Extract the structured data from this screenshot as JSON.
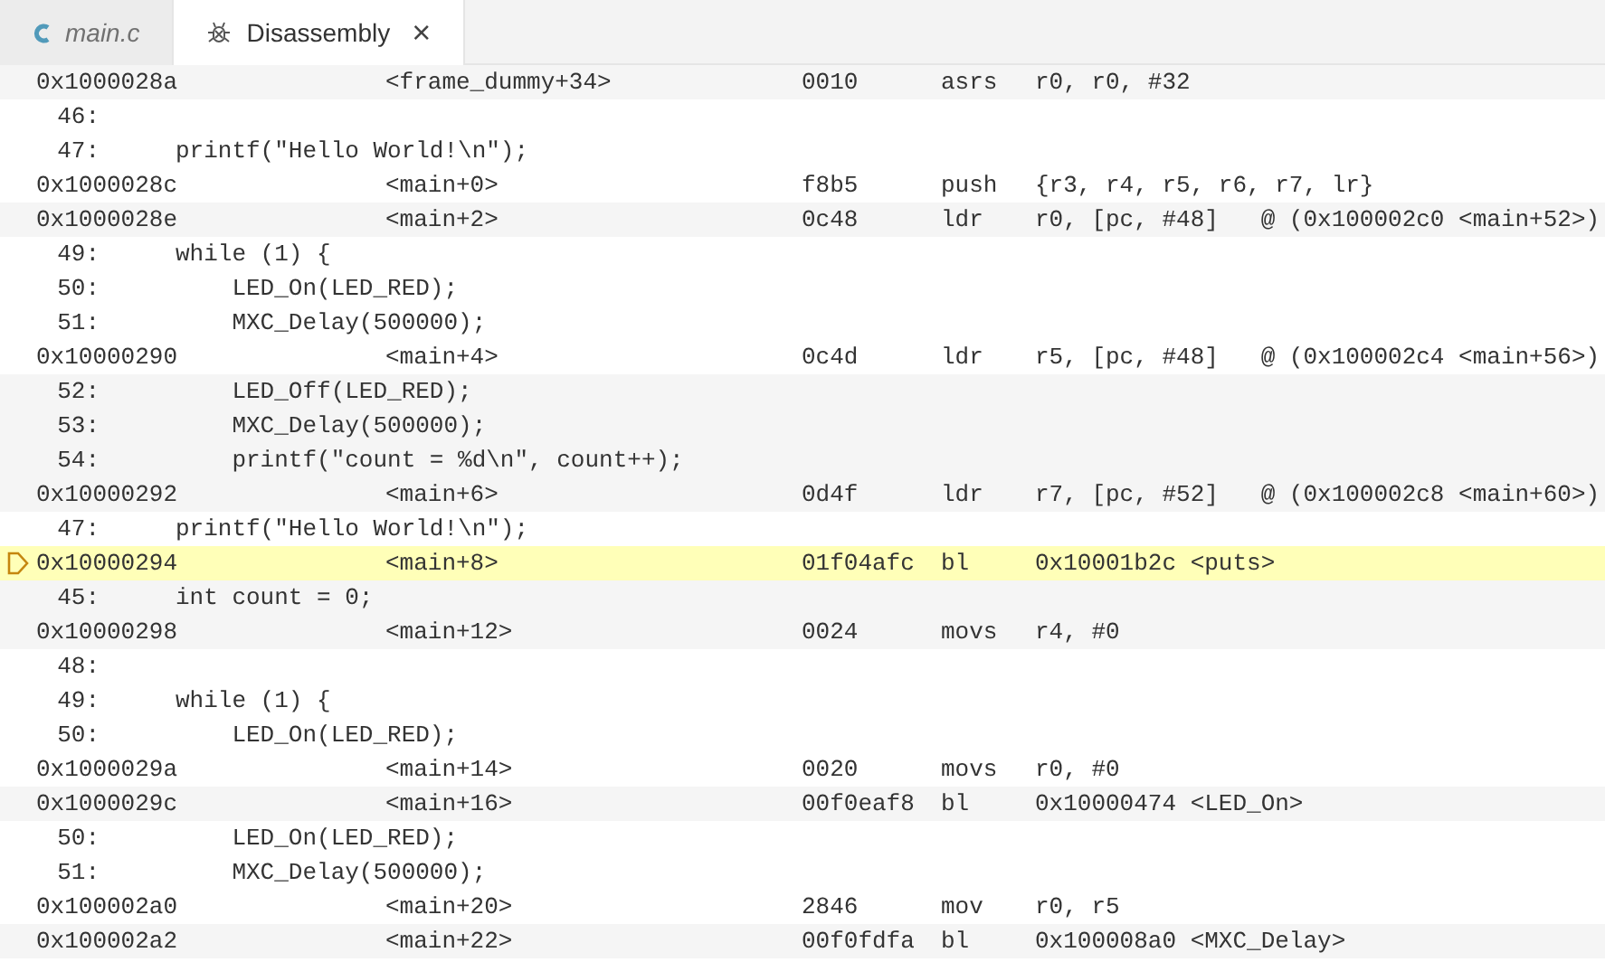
{
  "tabs": [
    {
      "label": "main.c",
      "kind": "c-file",
      "selected": false,
      "italic": true
    },
    {
      "label": "Disassembly",
      "kind": "disassembly",
      "selected": true,
      "italic": false,
      "close": "×"
    }
  ],
  "groups": [
    {
      "instruction": {
        "address": "0x1000028a",
        "symbol": "<frame_dummy+34>",
        "opcode": "0010",
        "mnemonic": "asrs",
        "operands": "r0, r0, #32",
        "current": false
      }
    },
    {
      "source": [
        {
          "line": "46:"
        },
        {
          "line": "47:",
          "code": "printf(\"Hello World!\\n\");"
        }
      ],
      "instruction": {
        "address": "0x1000028c",
        "symbol": "<main+0>",
        "opcode": "f8b5",
        "mnemonic": "push",
        "operands": "{r3, r4, r5, r6, r7, lr}",
        "current": false
      }
    },
    {
      "instruction": {
        "address": "0x1000028e",
        "symbol": "<main+2>",
        "opcode": "0c48",
        "mnemonic": "ldr",
        "operands": "r0, [pc, #48]   @ (0x100002c0 <main+52>)",
        "current": false
      }
    },
    {
      "source": [
        {
          "line": "49:",
          "code": "while (1) {"
        },
        {
          "line": "50:",
          "code": "    LED_On(LED_RED);"
        },
        {
          "line": "51:",
          "code": "    MXC_Delay(500000);"
        }
      ],
      "instruction": {
        "address": "0x10000290",
        "symbol": "<main+4>",
        "opcode": "0c4d",
        "mnemonic": "ldr",
        "operands": "r5, [pc, #48]   @ (0x100002c4 <main+56>)",
        "current": false
      }
    },
    {
      "source": [
        {
          "line": "52:",
          "code": "    LED_Off(LED_RED);"
        },
        {
          "line": "53:",
          "code": "    MXC_Delay(500000);"
        },
        {
          "line": "54:",
          "code": "    printf(\"count = %d\\n\", count++);"
        }
      ],
      "instruction": {
        "address": "0x10000292",
        "symbol": "<main+6>",
        "opcode": "0d4f",
        "mnemonic": "ldr",
        "operands": "r7, [pc, #52]   @ (0x100002c8 <main+60>)",
        "current": false
      }
    },
    {
      "source": [
        {
          "line": "47:",
          "code": "printf(\"Hello World!\\n\");"
        }
      ],
      "instruction": {
        "address": "0x10000294",
        "symbol": "<main+8>",
        "opcode": "01f04afc",
        "mnemonic": "bl",
        "operands": "0x10001b2c <puts>",
        "current": true
      }
    },
    {
      "source": [
        {
          "line": "45:",
          "code": "int count = 0;"
        }
      ],
      "instruction": {
        "address": "0x10000298",
        "symbol": "<main+12>",
        "opcode": "0024",
        "mnemonic": "movs",
        "operands": "r4, #0",
        "current": false
      }
    },
    {
      "source": [
        {
          "line": "48:"
        },
        {
          "line": "49:",
          "code": "while (1) {"
        },
        {
          "line": "50:",
          "code": "    LED_On(LED_RED);"
        }
      ],
      "instruction": {
        "address": "0x1000029a",
        "symbol": "<main+14>",
        "opcode": "0020",
        "mnemonic": "movs",
        "operands": "r0, #0",
        "current": false
      }
    },
    {
      "instruction": {
        "address": "0x1000029c",
        "symbol": "<main+16>",
        "opcode": "00f0eaf8",
        "mnemonic": "bl",
        "operands": "0x10000474 <LED_On>",
        "current": false
      }
    },
    {
      "source": [
        {
          "line": "50:",
          "code": "    LED_On(LED_RED);"
        },
        {
          "line": "51:",
          "code": "    MXC_Delay(500000);"
        }
      ],
      "instruction": {
        "address": "0x100002a0",
        "symbol": "<main+20>",
        "opcode": "2846",
        "mnemonic": "mov",
        "operands": "r0, r5",
        "current": false
      }
    },
    {
      "instruction": {
        "address": "0x100002a2",
        "symbol": "<main+22>",
        "opcode": "00f0fdfa",
        "mnemonic": "bl",
        "operands": "0x100008a0 <MXC_Delay>",
        "current": false
      }
    }
  ]
}
